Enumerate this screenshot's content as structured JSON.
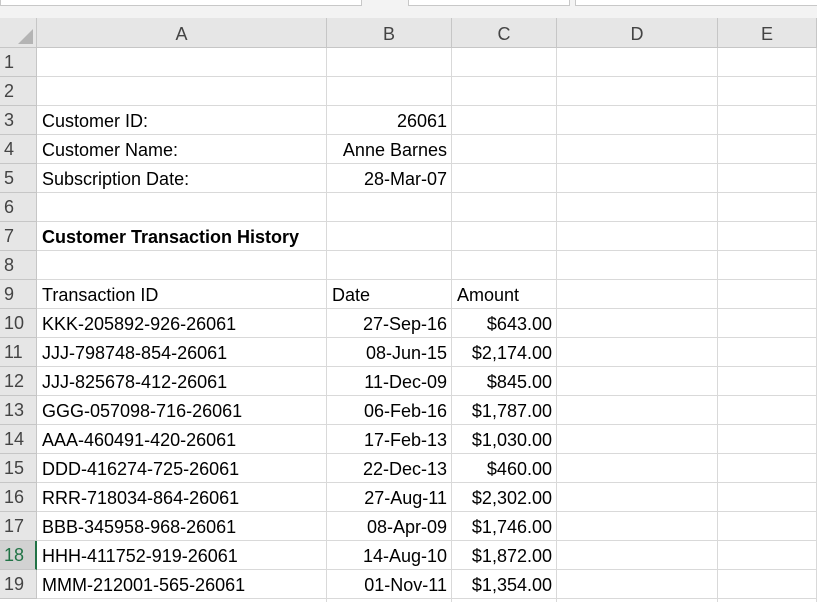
{
  "columns": [
    "A",
    "B",
    "C",
    "D",
    "E"
  ],
  "rows": [
    "1",
    "2",
    "3",
    "4",
    "5",
    "6",
    "7",
    "8",
    "9",
    "10",
    "11",
    "12",
    "13",
    "14",
    "15",
    "16",
    "17",
    "18",
    "19"
  ],
  "active_row": "18",
  "customer": {
    "id_label": "Customer ID:",
    "id_value": "26061",
    "name_label": "Customer Name:",
    "name_value": "Anne Barnes",
    "date_label": "Subscription Date:",
    "date_value": "28-Mar-07"
  },
  "section_title": "Customer Transaction History",
  "table": {
    "headers": [
      "Transaction ID",
      "Date",
      "Amount"
    ],
    "rows": [
      [
        "KKK-205892-926-26061",
        "27-Sep-16",
        "$643.00"
      ],
      [
        "JJJ-798748-854-26061",
        "08-Jun-15",
        "$2,174.00"
      ],
      [
        "JJJ-825678-412-26061",
        "11-Dec-09",
        "$845.00"
      ],
      [
        "GGG-057098-716-26061",
        "06-Feb-16",
        "$1,787.00"
      ],
      [
        "AAA-460491-420-26061",
        "17-Feb-13",
        "$1,030.00"
      ],
      [
        "DDD-416274-725-26061",
        "22-Dec-13",
        "$460.00"
      ],
      [
        "RRR-718034-864-26061",
        "27-Aug-11",
        "$2,302.00"
      ],
      [
        "BBB-345958-968-26061",
        "08-Apr-09",
        "$1,746.00"
      ],
      [
        "HHH-411752-919-26061",
        "14-Aug-10",
        "$1,872.00"
      ],
      [
        "MMM-212001-565-26061",
        "01-Nov-11",
        "$1,354.00"
      ]
    ]
  }
}
